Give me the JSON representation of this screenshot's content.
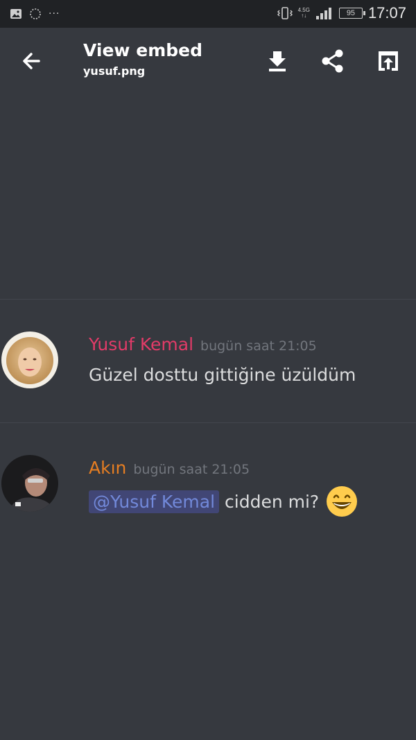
{
  "status_bar": {
    "dots": "···",
    "network": "4.5G",
    "battery": "95",
    "time": "17:07"
  },
  "app_bar": {
    "title": "View embed",
    "subtitle": "yusuf.png"
  },
  "messages": [
    {
      "author": "Yusuf Kemal",
      "author_color": "#e23b68",
      "timestamp": "bugün saat 21:05",
      "text": "Güzel dosttu gittiğine üzüldüm"
    },
    {
      "author": "Akın",
      "author_color": "#e67e22",
      "timestamp": "bugün saat 21:05",
      "mention": "@Yusuf Kemal",
      "text": "cidden mi?",
      "emoji": "grinning-face-emoji"
    }
  ],
  "colors": {
    "background": "#36393f",
    "status_bar": "#202225",
    "mention_bg": "#414675",
    "mention_text": "#7289da"
  }
}
